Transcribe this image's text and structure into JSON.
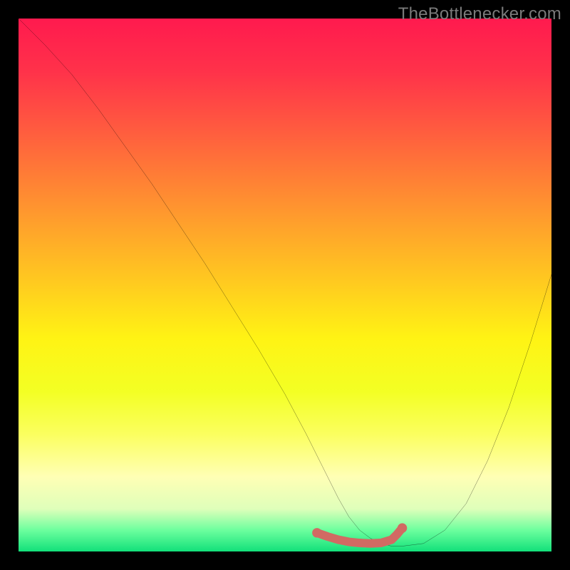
{
  "watermark": "TheBottlenecker.com",
  "chart_data": {
    "type": "line",
    "title": "",
    "xlabel": "",
    "ylabel": "",
    "xlim": [
      0,
      100
    ],
    "ylim": [
      0,
      100
    ],
    "grid": false,
    "series": [
      {
        "name": "curve",
        "color": "#000000",
        "x": [
          0,
          2,
          5,
          10,
          15,
          20,
          25,
          30,
          35,
          40,
          45,
          50,
          54,
          57,
          60,
          62,
          64,
          66,
          68,
          70,
          72,
          76,
          80,
          84,
          88,
          92,
          96,
          100
        ],
        "y": [
          100,
          98,
          95,
          89.5,
          83,
          76,
          69,
          61.5,
          54,
          46,
          38,
          29.5,
          22,
          16,
          10,
          6.5,
          4,
          2.5,
          1.5,
          1,
          1,
          1.5,
          4,
          9,
          17,
          27,
          39,
          52
        ]
      },
      {
        "name": "bottom-marker",
        "color": "#d16a63",
        "marker": true,
        "x": [
          56,
          58,
          60,
          62,
          64,
          66,
          68,
          70,
          71,
          72
        ],
        "y": [
          3.5,
          2.8,
          2.2,
          1.8,
          1.6,
          1.5,
          1.6,
          2.2,
          3.2,
          4.4
        ]
      }
    ],
    "gradient_bands": {
      "direction": "vertical",
      "stops": [
        {
          "pos": 0.0,
          "color": "#ff1a4e"
        },
        {
          "pos": 0.5,
          "color": "#ffcc1f"
        },
        {
          "pos": 0.78,
          "color": "#fbff5f"
        },
        {
          "pos": 1.0,
          "color": "#12e07a"
        }
      ]
    }
  }
}
